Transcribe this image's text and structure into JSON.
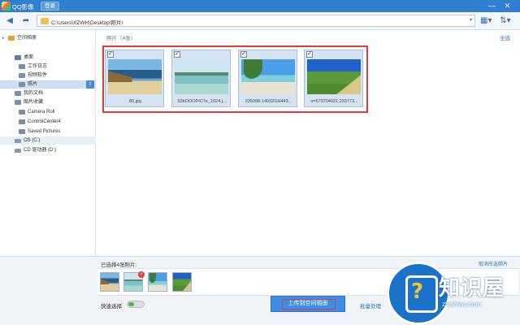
{
  "titlebar": {
    "app_title": "QQ影像",
    "login_label": "登录",
    "minimize_glyph": "—",
    "close_glyph": "✕"
  },
  "toolbar": {
    "back_glyph": "◀",
    "forward_glyph": "➦",
    "path": "C:\\Users\\XZWH\\Desktop\\照片\\",
    "dropdown_glyph": "▾",
    "view_glyph": "▦▾",
    "sort_glyph": "⇅▾"
  },
  "sidebar": {
    "items": [
      {
        "label": "空间相册",
        "icon": "cloud-album-icon"
      },
      {
        "label": "桌面",
        "icon": "desktop-icon"
      },
      {
        "label": "工作日志",
        "icon": "folder-icon"
      },
      {
        "label": "视频软件",
        "icon": "folder-icon"
      },
      {
        "label": "照片",
        "icon": "folder-icon",
        "selected": true
      },
      {
        "label": "我的文档",
        "icon": "folder-icon"
      },
      {
        "label": "图片收藏",
        "icon": "folder-icon"
      },
      {
        "label": "Camera Roll",
        "icon": "folder-icon"
      },
      {
        "label": "ControlCenter4",
        "icon": "folder-icon"
      },
      {
        "label": "Saved Pictures",
        "icon": "folder-icon"
      },
      {
        "label": "OS (C:)",
        "icon": "disk-icon"
      },
      {
        "label": "CD 驱动器 (D:)",
        "icon": "cd-drive-icon"
      }
    ],
    "pin_glyph": "⇧"
  },
  "main": {
    "crumb": "照片（4张）",
    "select_all": "全选",
    "thumbnails": [
      {
        "caption": "80.jpg",
        "check": "✓"
      },
      {
        "caption": "92bOOOPIC7e_1024.j...",
        "check": "✓"
      },
      {
        "caption": "235088-14032GH443...",
        "check": "✓"
      },
      {
        "caption": "u=579704021,233773...",
        "check": "✓"
      }
    ]
  },
  "bottom": {
    "selected_count": "已选择4张照片:",
    "cancel_selected": "取消所选照片",
    "remove_glyph": "×",
    "quick_select": "快速选择",
    "upload_label": "上传到空间相册",
    "batch_link": "批量处理"
  },
  "watermark": {
    "title": "知识屋",
    "subtitle": "zhishiwu.com",
    "glyph": "?"
  }
}
